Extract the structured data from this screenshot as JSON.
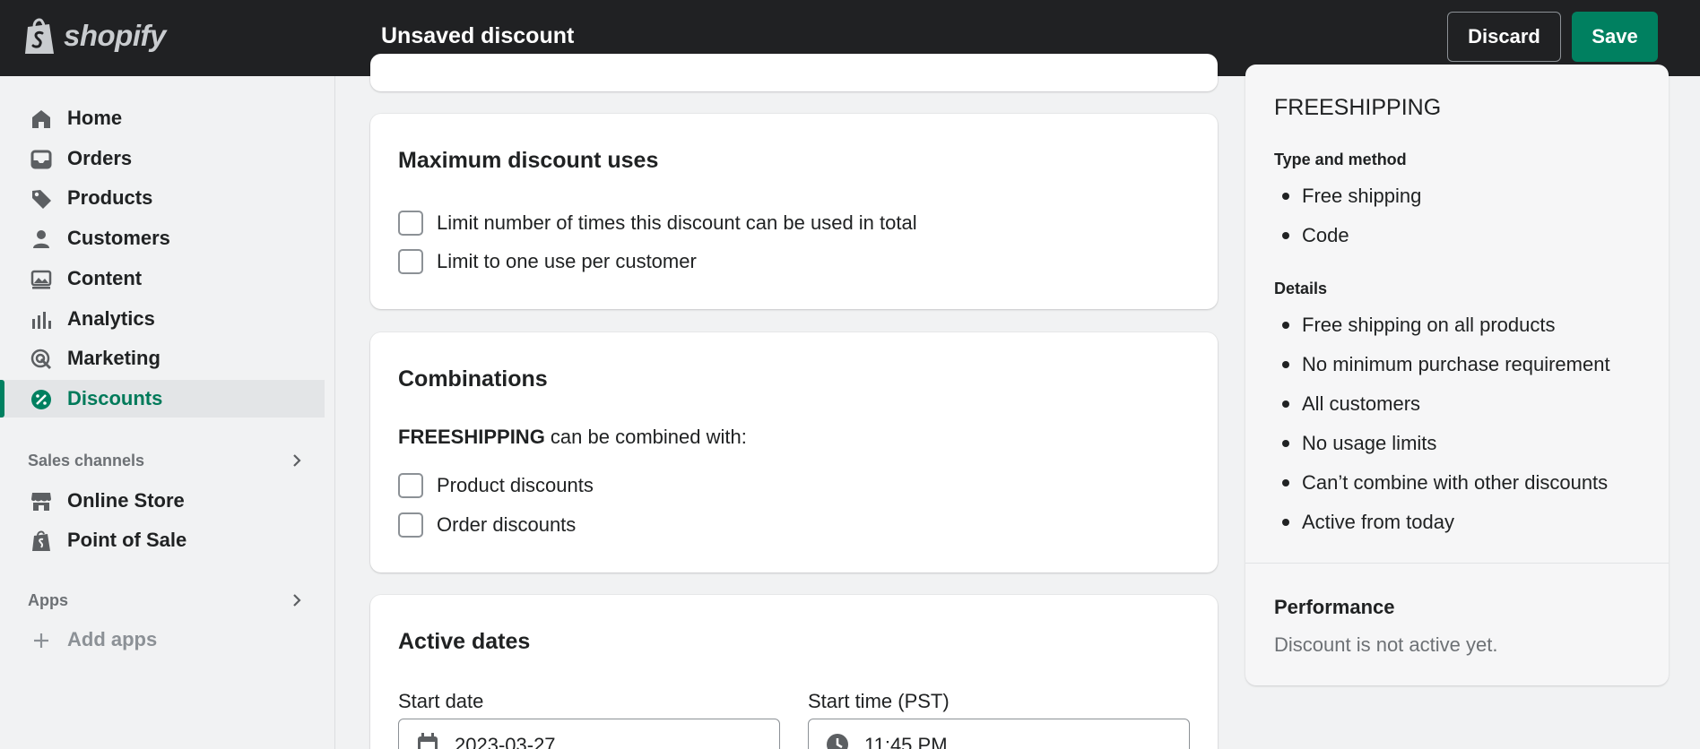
{
  "topbar": {
    "logo_text": "shopify",
    "title": "Unsaved discount",
    "discard_label": "Discard",
    "save_label": "Save",
    "accent_color": "#008060"
  },
  "sidebar": {
    "items": [
      {
        "label": "Home",
        "icon": "home-icon"
      },
      {
        "label": "Orders",
        "icon": "inbox-icon"
      },
      {
        "label": "Products",
        "icon": "tag-icon"
      },
      {
        "label": "Customers",
        "icon": "person-icon"
      },
      {
        "label": "Content",
        "icon": "image-icon"
      },
      {
        "label": "Analytics",
        "icon": "bar-chart-icon"
      },
      {
        "label": "Marketing",
        "icon": "target-icon"
      },
      {
        "label": "Discounts",
        "icon": "discount-icon",
        "active": true
      }
    ],
    "sales_channels_header": "Sales channels",
    "sales_channels": [
      {
        "label": "Online Store",
        "icon": "store-icon"
      },
      {
        "label": "Point of Sale",
        "icon": "pos-icon"
      }
    ],
    "apps_header": "Apps",
    "add_apps_label": "Add apps"
  },
  "max_uses": {
    "title": "Maximum discount uses",
    "options": [
      {
        "label": "Limit number of times this discount can be used in total",
        "checked": false
      },
      {
        "label": "Limit to one use per customer",
        "checked": false
      }
    ]
  },
  "combinations": {
    "title": "Combinations",
    "code": "FREESHIPPING",
    "text_suffix": " can be combined with:",
    "options": [
      {
        "label": "Product discounts",
        "checked": false
      },
      {
        "label": "Order discounts",
        "checked": false
      }
    ]
  },
  "active_dates": {
    "title": "Active dates",
    "start_date_label": "Start date",
    "start_date_value": "2023-03-27",
    "start_time_label": "Start time (PST)",
    "start_time_value": "11:45 PM"
  },
  "summary": {
    "code": "FREESHIPPING",
    "type_header": "Type and method",
    "type_items": [
      "Free shipping",
      "Code"
    ],
    "details_header": "Details",
    "details_items": [
      "Free shipping on all products",
      "No minimum purchase requirement",
      "All customers",
      "No usage limits",
      "Can’t combine with other discounts",
      "Active from today"
    ],
    "performance_title": "Performance",
    "performance_text": "Discount is not active yet."
  }
}
